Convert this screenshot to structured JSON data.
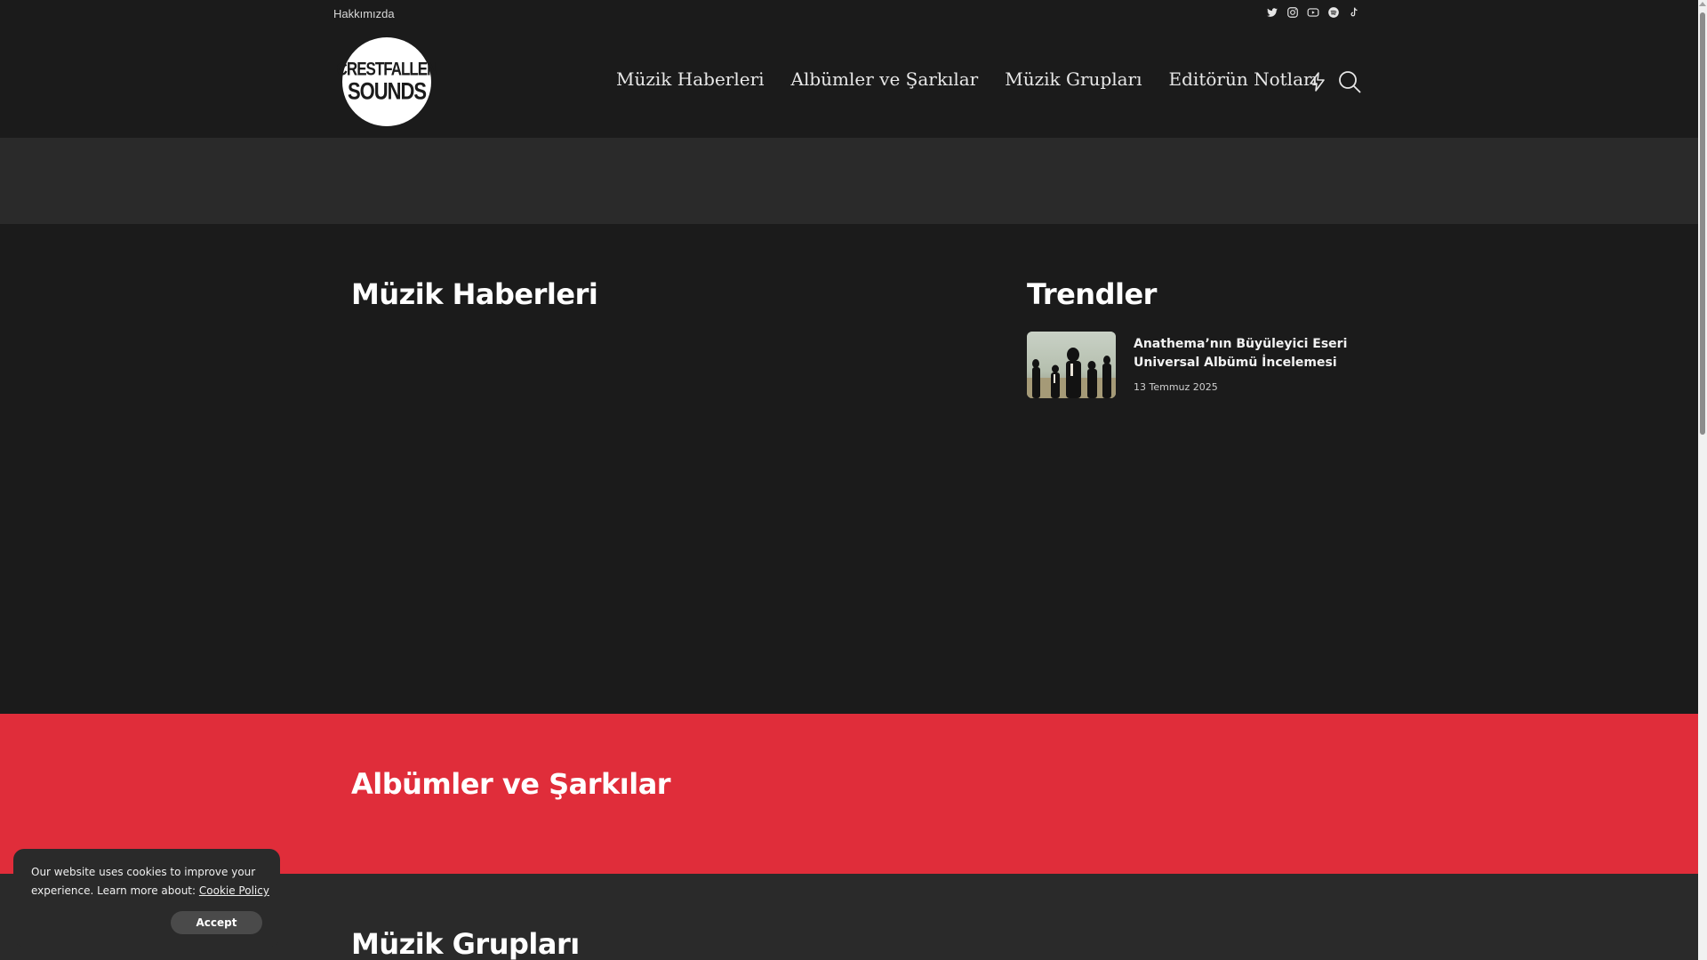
{
  "topbar": {
    "about_link": "Hakkımızda",
    "social_icons": [
      "twitter-icon",
      "instagram-icon",
      "youtube-icon",
      "spotify-icon",
      "tiktok-icon"
    ]
  },
  "header": {
    "logo_line1": "CRESTFALLEN",
    "logo_line2": "SOUNDS",
    "nav": [
      {
        "label": "Müzik Haberleri"
      },
      {
        "label": "Albümler ve Şarkılar"
      },
      {
        "label": "Müzik Grupları"
      },
      {
        "label": "Editörün Notları"
      }
    ],
    "icons": [
      "bolt-icon",
      "search-icon"
    ]
  },
  "main": {
    "news_title": "Müzik Haberleri",
    "trends_title": "Trendler",
    "trends": [
      {
        "title": "Anathema’nın Büyüleyici Eseri Universal Albümü İncelemesi",
        "date": "13 Temmuz 2025"
      }
    ]
  },
  "albums_section": {
    "title": "Albümler ve Şarkılar"
  },
  "groups_section": {
    "title": "Müzik Grupları"
  },
  "cookie": {
    "text": "Our website uses cookies to improve your experience. Learn more about:",
    "link": "Cookie Policy",
    "accept": "Accept"
  },
  "colors": {
    "background": "#1b1b1b",
    "band": "#2a2a2a",
    "accent_red": "#e02d3a"
  }
}
